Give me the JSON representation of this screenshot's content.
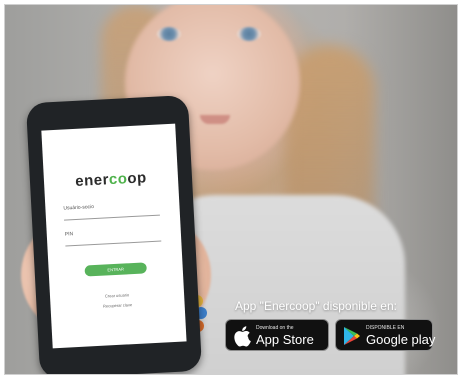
{
  "phone_app": {
    "brand_prefix": "ener",
    "brand_highlight": "co",
    "brand_suffix": "op",
    "username_label": "Usuário-socio",
    "password_label": "PIN",
    "login_button": "ENTRAR",
    "link_1": "Crear usuario",
    "link_2": "Recuperar clave"
  },
  "promo": {
    "title": "App \"Enercoop\" disponible en:",
    "appstore": {
      "small": "Download on the",
      "big": "App Store"
    },
    "googleplay": {
      "small": "DISPONIBLE EN",
      "big": "Google play"
    }
  },
  "colors": {
    "brand_green": "#4fb24c",
    "badge_bg": "#111111"
  },
  "icons": [
    "apple-icon",
    "google-play-icon"
  ]
}
